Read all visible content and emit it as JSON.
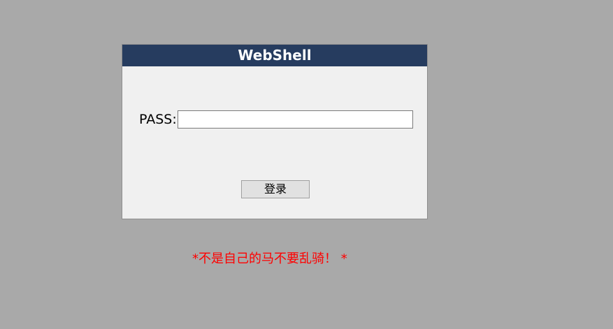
{
  "login": {
    "title": "WebShell",
    "pass_label": "PASS:",
    "pass_value": "",
    "submit_label": "登录"
  },
  "warning": "*不是自己的马不要乱骑！ *",
  "colors": {
    "background": "#a9a9a9",
    "header": "#263c5f",
    "panel": "#f0f0f0",
    "warning": "#ff0000"
  }
}
